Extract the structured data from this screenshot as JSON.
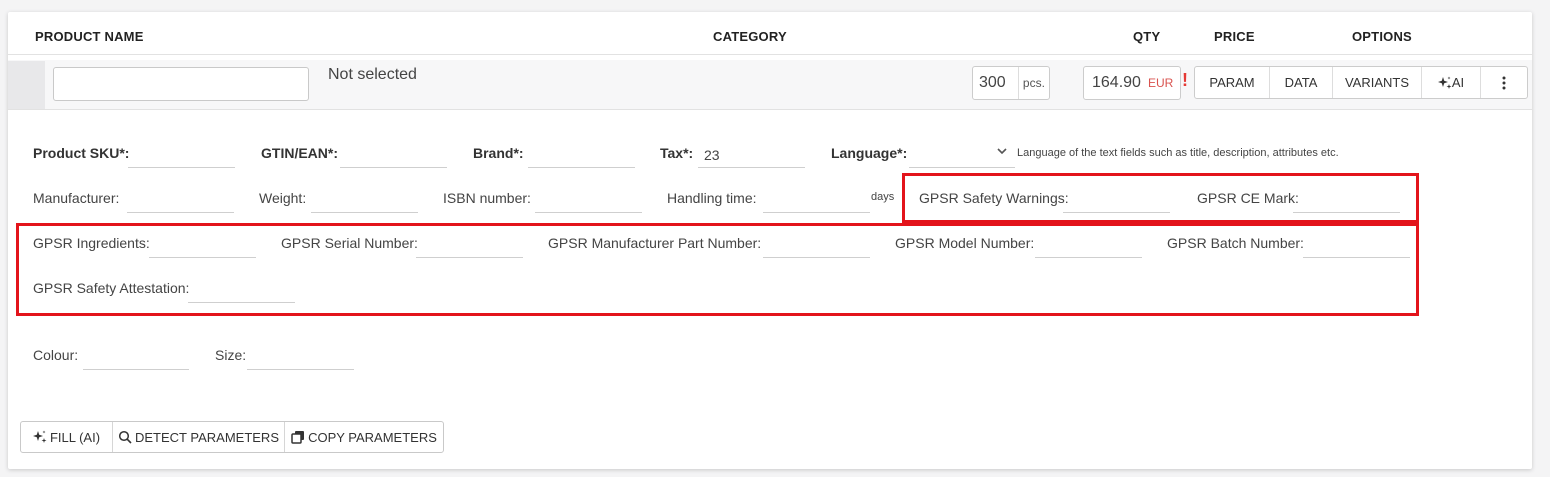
{
  "table_header": {
    "product_name": "PRODUCT NAME",
    "category": "CATEGORY",
    "qty": "QTY",
    "price": "PRICE",
    "options": "OPTIONS"
  },
  "product_row": {
    "name_value": "",
    "category_value": "Not selected",
    "qty_value": "300",
    "qty_unit": "pcs.",
    "price_value": "164.90",
    "price_currency": "EUR",
    "alert_mark": "!",
    "options": {
      "param": "PARAM",
      "data": "DATA",
      "variants": "VARIANTS",
      "ai": "AI",
      "more_icon": "vertical-ellipsis-icon",
      "ai_icon": "sparkle-icon"
    }
  },
  "fields": {
    "sku": {
      "label": "Product SKU*:",
      "value": ""
    },
    "gtin": {
      "label": "GTIN/EAN*:",
      "value": ""
    },
    "brand": {
      "label": "Brand*:",
      "value": ""
    },
    "tax": {
      "label": "Tax*:",
      "value": "23"
    },
    "language": {
      "label": "Language*:",
      "value": "",
      "hint": "Language of the text fields such as title, description, attributes etc."
    },
    "manufacturer": {
      "label": "Manufacturer:",
      "value": ""
    },
    "weight": {
      "label": "Weight:",
      "value": ""
    },
    "isbn": {
      "label": "ISBN number:",
      "value": ""
    },
    "handling_time": {
      "label": "Handling time:",
      "value": "",
      "unit": "days"
    },
    "gpsr_safety_warnings": {
      "label": "GPSR Safety Warnings:",
      "value": ""
    },
    "gpsr_ce_mark": {
      "label": "GPSR CE Mark:",
      "value": ""
    },
    "gpsr_ingredients": {
      "label": "GPSR Ingredients:",
      "value": ""
    },
    "gpsr_serial_number": {
      "label": "GPSR Serial Number:",
      "value": ""
    },
    "gpsr_mpn": {
      "label": "GPSR Manufacturer Part Number:",
      "value": ""
    },
    "gpsr_model_number": {
      "label": "GPSR Model Number:",
      "value": ""
    },
    "gpsr_batch_number": {
      "label": "GPSR Batch Number:",
      "value": ""
    },
    "gpsr_safety_attestation": {
      "label": "GPSR Safety Attestation:",
      "value": ""
    },
    "colour": {
      "label": "Colour:",
      "value": ""
    },
    "size": {
      "label": "Size:",
      "value": ""
    }
  },
  "actions": {
    "fill_ai": "FILL (AI)",
    "detect": "DETECT PARAMETERS",
    "copy": "COPY PARAMETERS",
    "fill_icon": "sparkle-icon",
    "detect_icon": "search-icon",
    "copy_icon": "copy-icon"
  },
  "colors": {
    "highlight": "#e3141b",
    "currency": "#d9534f",
    "alert": "#e53935"
  }
}
